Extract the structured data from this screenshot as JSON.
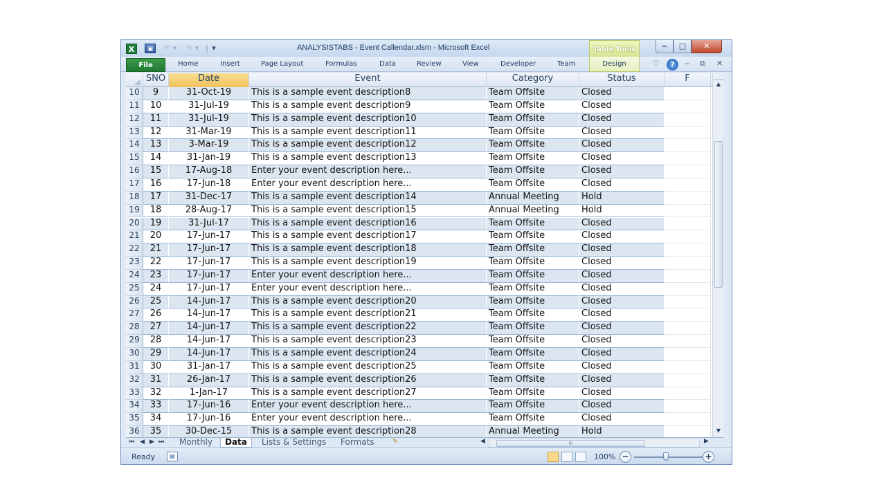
{
  "window": {
    "title": "ANALYSISTABS - Event Callendar.xlsm - Microsoft Excel",
    "app_icon": "X",
    "quick_access": {
      "save_icon": "save-icon",
      "undo_glyph": "↶ ▾",
      "redo_glyph": "↷ ▾",
      "separator": "|",
      "customize_glyph": "▾"
    },
    "controls": {
      "minimize": "‒",
      "maximize": "□",
      "close": "✕"
    }
  },
  "ribbon": {
    "file_label": "File",
    "tabs": [
      "Home",
      "Insert",
      "Page Layout",
      "Formulas",
      "Data",
      "Review",
      "View",
      "Developer",
      "Team"
    ],
    "context_group": "Table Tools",
    "context_tab": "Design",
    "right_glyphs": {
      "minimize_ribbon": "♡",
      "help": "?",
      "restore_min": "‒",
      "restore": "⧉",
      "close": "✕"
    }
  },
  "grid": {
    "columns": [
      {
        "key": "sno",
        "label": "SNO"
      },
      {
        "key": "date",
        "label": "Date"
      },
      {
        "key": "event",
        "label": "Event"
      },
      {
        "key": "category",
        "label": "Category"
      },
      {
        "key": "status",
        "label": "Status"
      },
      {
        "key": "f",
        "label": "F"
      }
    ],
    "rows": [
      {
        "rn": "10",
        "sno": "9",
        "date": "31-Oct-19",
        "event": "This is a sample event description8",
        "category": "Team Offsite",
        "status": "Closed"
      },
      {
        "rn": "11",
        "sno": "10",
        "date": "31-Jul-19",
        "event": "This is a sample event description9",
        "category": "Team Offsite",
        "status": "Closed"
      },
      {
        "rn": "12",
        "sno": "11",
        "date": "31-Jul-19",
        "event": "This is a sample event description10",
        "category": "Team Offsite",
        "status": "Closed"
      },
      {
        "rn": "13",
        "sno": "12",
        "date": "31-Mar-19",
        "event": "This is a sample event description11",
        "category": "Team Offsite",
        "status": "Closed"
      },
      {
        "rn": "14",
        "sno": "13",
        "date": "3-Mar-19",
        "event": "This is a sample event description12",
        "category": "Team Offsite",
        "status": "Closed"
      },
      {
        "rn": "15",
        "sno": "14",
        "date": "31-Jan-19",
        "event": "This is a sample event description13",
        "category": "Team Offsite",
        "status": "Closed"
      },
      {
        "rn": "16",
        "sno": "15",
        "date": "17-Aug-18",
        "event": "Enter your event description here...",
        "category": "Team Offsite",
        "status": "Closed"
      },
      {
        "rn": "17",
        "sno": "16",
        "date": "17-Jun-18",
        "event": "Enter your event description here...",
        "category": "Team Offsite",
        "status": "Closed"
      },
      {
        "rn": "18",
        "sno": "17",
        "date": "31-Dec-17",
        "event": "This is a sample event description14",
        "category": "Annual Meeting",
        "status": "Hold"
      },
      {
        "rn": "19",
        "sno": "18",
        "date": "28-Aug-17",
        "event": "This is a sample event description15",
        "category": "Annual Meeting",
        "status": "Hold"
      },
      {
        "rn": "20",
        "sno": "19",
        "date": "31-Jul-17",
        "event": "This is a sample event description16",
        "category": "Team Offsite",
        "status": "Closed"
      },
      {
        "rn": "21",
        "sno": "20",
        "date": "17-Jun-17",
        "event": "This is a sample event description17",
        "category": "Team Offsite",
        "status": "Closed"
      },
      {
        "rn": "22",
        "sno": "21",
        "date": "17-Jun-17",
        "event": "This is a sample event description18",
        "category": "Team Offsite",
        "status": "Closed"
      },
      {
        "rn": "23",
        "sno": "22",
        "date": "17-Jun-17",
        "event": "This is a sample event description19",
        "category": "Team Offsite",
        "status": "Closed"
      },
      {
        "rn": "24",
        "sno": "23",
        "date": "17-Jun-17",
        "event": "Enter your event description here...",
        "category": "Team Offsite",
        "status": "Closed"
      },
      {
        "rn": "25",
        "sno": "24",
        "date": "17-Jun-17",
        "event": "Enter your event description here...",
        "category": "Team Offsite",
        "status": "Closed"
      },
      {
        "rn": "26",
        "sno": "25",
        "date": "14-Jun-17",
        "event": "This is a sample event description20",
        "category": "Team Offsite",
        "status": "Closed"
      },
      {
        "rn": "27",
        "sno": "26",
        "date": "14-Jun-17",
        "event": "This is a sample event description21",
        "category": "Team Offsite",
        "status": "Closed"
      },
      {
        "rn": "28",
        "sno": "27",
        "date": "14-Jun-17",
        "event": "This is a sample event description22",
        "category": "Team Offsite",
        "status": "Closed"
      },
      {
        "rn": "29",
        "sno": "28",
        "date": "14-Jun-17",
        "event": "This is a sample event description23",
        "category": "Team Offsite",
        "status": "Closed"
      },
      {
        "rn": "30",
        "sno": "29",
        "date": "14-Jun-17",
        "event": "This is a sample event description24",
        "category": "Team Offsite",
        "status": "Closed"
      },
      {
        "rn": "31",
        "sno": "30",
        "date": "31-Jan-17",
        "event": "This is a sample event description25",
        "category": "Team Offsite",
        "status": "Closed"
      },
      {
        "rn": "32",
        "sno": "31",
        "date": "26-Jan-17",
        "event": "This is a sample event description26",
        "category": "Team Offsite",
        "status": "Closed"
      },
      {
        "rn": "33",
        "sno": "32",
        "date": "1-Jan-17",
        "event": "This is a sample event description27",
        "category": "Team Offsite",
        "status": "Closed"
      },
      {
        "rn": "34",
        "sno": "33",
        "date": "17-Jun-16",
        "event": "Enter your event description here...",
        "category": "Team Offsite",
        "status": "Closed"
      },
      {
        "rn": "35",
        "sno": "34",
        "date": "17-Jun-16",
        "event": "Enter your event description here...",
        "category": "Team Offsite",
        "status": "Closed"
      },
      {
        "rn": "36",
        "sno": "35",
        "date": "30-Dec-15",
        "event": "This is a sample event description28",
        "category": "Annual Meeting",
        "status": "Hold"
      }
    ]
  },
  "sheet_tabs": {
    "nav": [
      "⏮",
      "◀",
      "▶",
      "⏭"
    ],
    "tabs": [
      "Monthly",
      "Data",
      "Lists & Settings",
      "Formats"
    ],
    "active": "Data",
    "insert_glyph": "✎"
  },
  "hscroll": {
    "thumb_glyph": "III",
    "left": "◀",
    "right": "▶"
  },
  "status_bar": {
    "ready": "Ready",
    "zoom": "100%",
    "zoom_out": "−",
    "zoom_in": "+",
    "zoom_level": 0.42
  },
  "colors": {
    "band": "#dce6f1",
    "header_sel": "#f1c15b",
    "file_tab": "#1e7b32"
  }
}
